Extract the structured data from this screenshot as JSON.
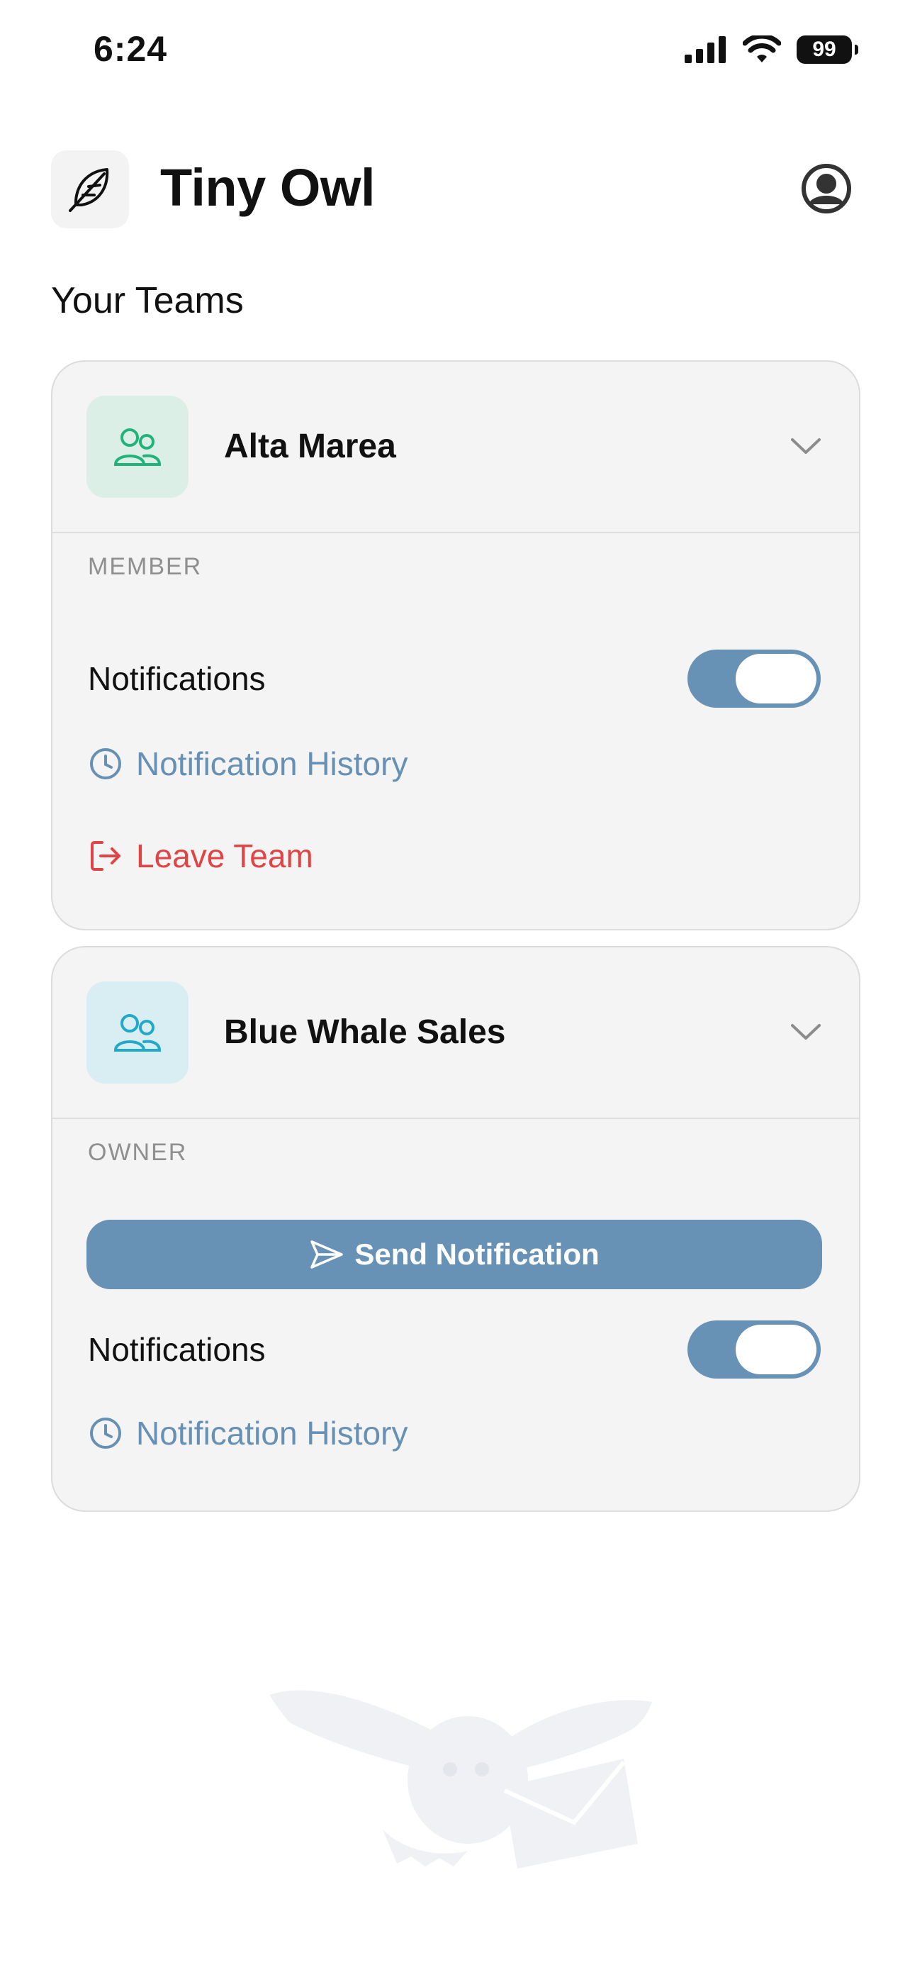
{
  "status_bar": {
    "time": "6:24",
    "battery": "99"
  },
  "app": {
    "title": "Tiny Owl"
  },
  "section": {
    "title": "Your Teams"
  },
  "teams": [
    {
      "name": "Alta Marea",
      "role": "MEMBER",
      "icon_bg": "#dcefe6",
      "icon_color": "#22b37a",
      "notifications_label": "Notifications",
      "notifications_on": true,
      "history_label": "Notification History",
      "leave_label": "Leave Team"
    },
    {
      "name": "Blue Whale Sales",
      "role": "OWNER",
      "icon_bg": "#d9eef3",
      "icon_color": "#22a9c9",
      "send_label": "Send Notification",
      "notifications_label": "Notifications",
      "notifications_on": true,
      "history_label": "Notification History"
    }
  ],
  "colors": {
    "accent": "#6891b6",
    "danger": "#e04444",
    "card_bg": "#f4f4f4"
  }
}
